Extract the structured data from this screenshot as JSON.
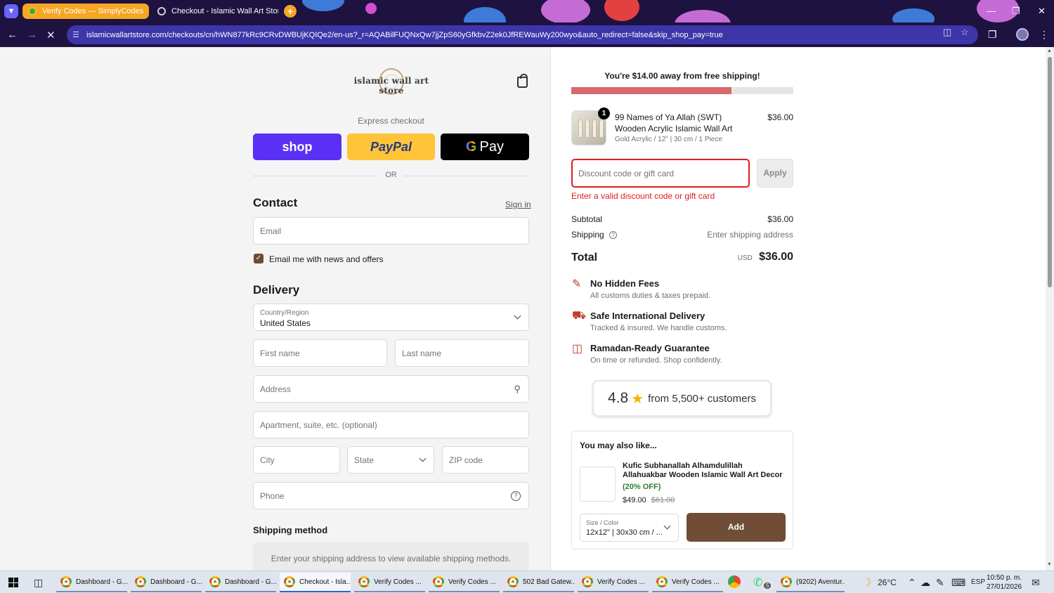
{
  "browser": {
    "tabs": [
      {
        "title": "Verify Codes — SimplyCodes",
        "active": false
      },
      {
        "title": "Checkout - Islamic Wall Art Stor",
        "active": true
      }
    ],
    "new_tab_icon": "plus-icon",
    "url": "islamicwallartstore.com/checkouts/cn/hWN877kRc9CRvDWBUjKQIQe2/en-us?_r=AQABilFUQNxQw7jjZpS60yGfkbvZ2ek0JfREWauWy200wyo&auto_redirect=false&skip_shop_pay=true"
  },
  "store": {
    "logo_text": "islamic wall art store"
  },
  "express": {
    "label": "Express checkout",
    "shop_label": "shop",
    "paypal_label": "PayPal",
    "gpay_label": "Pay",
    "or_label": "OR"
  },
  "contact": {
    "heading": "Contact",
    "sign_in": "Sign in",
    "email_placeholder": "Email",
    "newsletter_label": "Email me with news and offers",
    "newsletter_checked": true
  },
  "delivery": {
    "heading": "Delivery",
    "country_label": "Country/Region",
    "country_value": "United States",
    "first_name": "First name",
    "last_name": "Last name",
    "address": "Address",
    "apartment": "Apartment, suite, etc. (optional)",
    "city": "City",
    "state": "State",
    "zip": "ZIP code",
    "phone": "Phone"
  },
  "shipping_method": {
    "heading": "Shipping method",
    "message": "Enter your shipping address to view available shipping methods."
  },
  "summary": {
    "free_shipping_banner": "You're $14.00 away from free shipping!",
    "free_shipping_progress": 0.72,
    "item": {
      "quantity": "1",
      "title": "99 Names of Ya Allah (SWT) Wooden Acrylic Islamic Wall Art",
      "variant": "Gold Acrylic / 12\" | 30 cm / 1 Piece",
      "price": "$36.00"
    },
    "discount_placeholder": "Discount code or gift card",
    "apply_label": "Apply",
    "discount_error": "Enter a valid discount code or gift card",
    "subtotal_label": "Subtotal",
    "subtotal_value": "$36.00",
    "shipping_label": "Shipping",
    "shipping_value": "Enter shipping address",
    "total_label": "Total",
    "total_currency": "USD",
    "total_value": "$36.00"
  },
  "features": [
    {
      "icon": "pencil-icon",
      "title": "No Hidden Fees",
      "subtitle": "All customs duties & taxes prepaid."
    },
    {
      "icon": "truck-icon",
      "title": "Safe International Delivery",
      "subtitle": "Tracked & insured. We handle customs."
    },
    {
      "icon": "gift-icon",
      "title": "Ramadan-Ready Guarantee",
      "subtitle": "On time or refunded. Shop confidently."
    }
  ],
  "rating": {
    "score": "4.8",
    "text": "from 5,500+ customers"
  },
  "upsell": {
    "heading": "You may also like...",
    "product_name": "Kufic Subhanallah Alhamdulillah Allahuakbar Wooden Islamic Wall Art Decor",
    "discount": "(20% OFF)",
    "price": "$49.00",
    "old_price": "$61.00",
    "select_label": "Size / Color",
    "select_value": "12x12\" | 30x30 cm / ...",
    "add_label": "Add"
  },
  "taskbar": {
    "items": [
      "Dashboard - G...",
      "Dashboard - G...",
      "Dashboard - G...",
      "Checkout - Isla...",
      "Verify Codes ...",
      "Verify Codes ...",
      "502 Bad Gatew...",
      "Verify Codes ...",
      "Verify Codes ...",
      "(9202) Aventur..."
    ],
    "weather": "26°C",
    "language": "ESP",
    "time": "10:50 p. m.",
    "date": "27/01/2026",
    "whatsapp_badge": "5"
  },
  "colors": {
    "accent_brown": "#6f4d36",
    "shop_purple": "#5a31f4",
    "paypal_yellow": "#ffc439",
    "error_red": "#dd1d1d",
    "progress_fill": "#d9686b"
  }
}
